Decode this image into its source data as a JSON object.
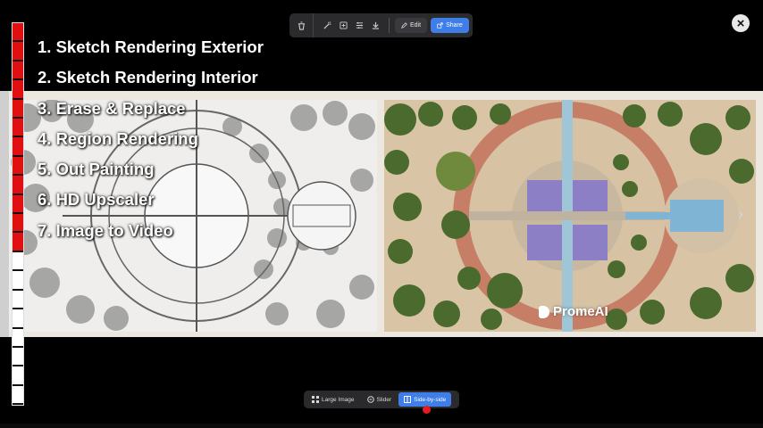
{
  "toolbar": {
    "edit_label": "Edit",
    "share_label": "Share"
  },
  "features": [
    "1. Sketch Rendering Exterior",
    "2. Sketch Rendering Interior",
    "3. Erase & Replace",
    "4. Region Rendering",
    "5. Out Painting",
    "6. HD Upscaler",
    "7. Image to Video"
  ],
  "watermark": "PromeAI",
  "view_modes": {
    "large_image": "Large Image",
    "slider": "Slider",
    "side_by_side": "Side-by-side",
    "active": "Side-by-side"
  },
  "progress": {
    "filled_fraction": 0.6
  },
  "colors": {
    "accent": "#3f7de8",
    "progress_fill": "#e01010",
    "toolbar_bg": "#2b2b2e"
  }
}
